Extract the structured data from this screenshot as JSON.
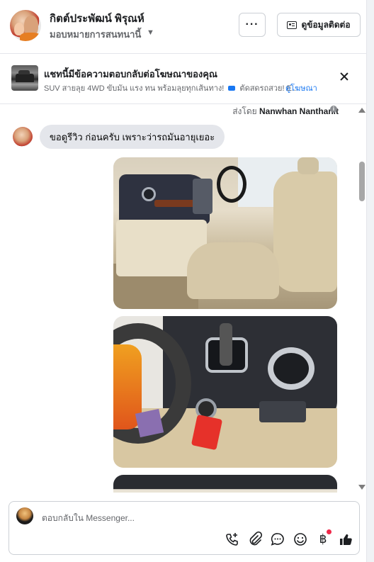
{
  "header": {
    "name": "กิตต์ประพัฒน์ พิรุณห์",
    "assign_label": "มอบหมายการสนทนานี้",
    "more_label": "···",
    "contact_label": "ดูข้อมูลติดต่อ"
  },
  "ad_banner": {
    "title": "แชทนี้มีข้อความตอบกลับต่อโฆษณาของคุณ",
    "description_a": "SUV สายลุย 4WD ขับมัน แรง ทน พร้อมลุยทุกเส้นทาง!",
    "description_b": "ตัดสดรถสวย! E...",
    "link_label": "ดูโฆษณา"
  },
  "thread": {
    "sent_by_prefix": "ส่งโดย",
    "sent_by_name": "Nanwhan Nanthanit",
    "message_text": "ขอดูรีวิว ก่อนครับ เพราะว่ารถมันอายุเยอะ",
    "info_icon": "i"
  },
  "composer": {
    "placeholder": "ตอบกลับใน Messenger...",
    "tools": [
      "phone-plus-icon",
      "paperclip-icon",
      "chat-bubble-icon",
      "smile-icon",
      "baht-icon",
      "thumbs-up-icon"
    ],
    "baht_symbol": "฿"
  },
  "colors": {
    "accent": "#1877f2",
    "bubble": "#e4e6eb",
    "border": "#ccd0d5",
    "notification": "#f02849"
  }
}
